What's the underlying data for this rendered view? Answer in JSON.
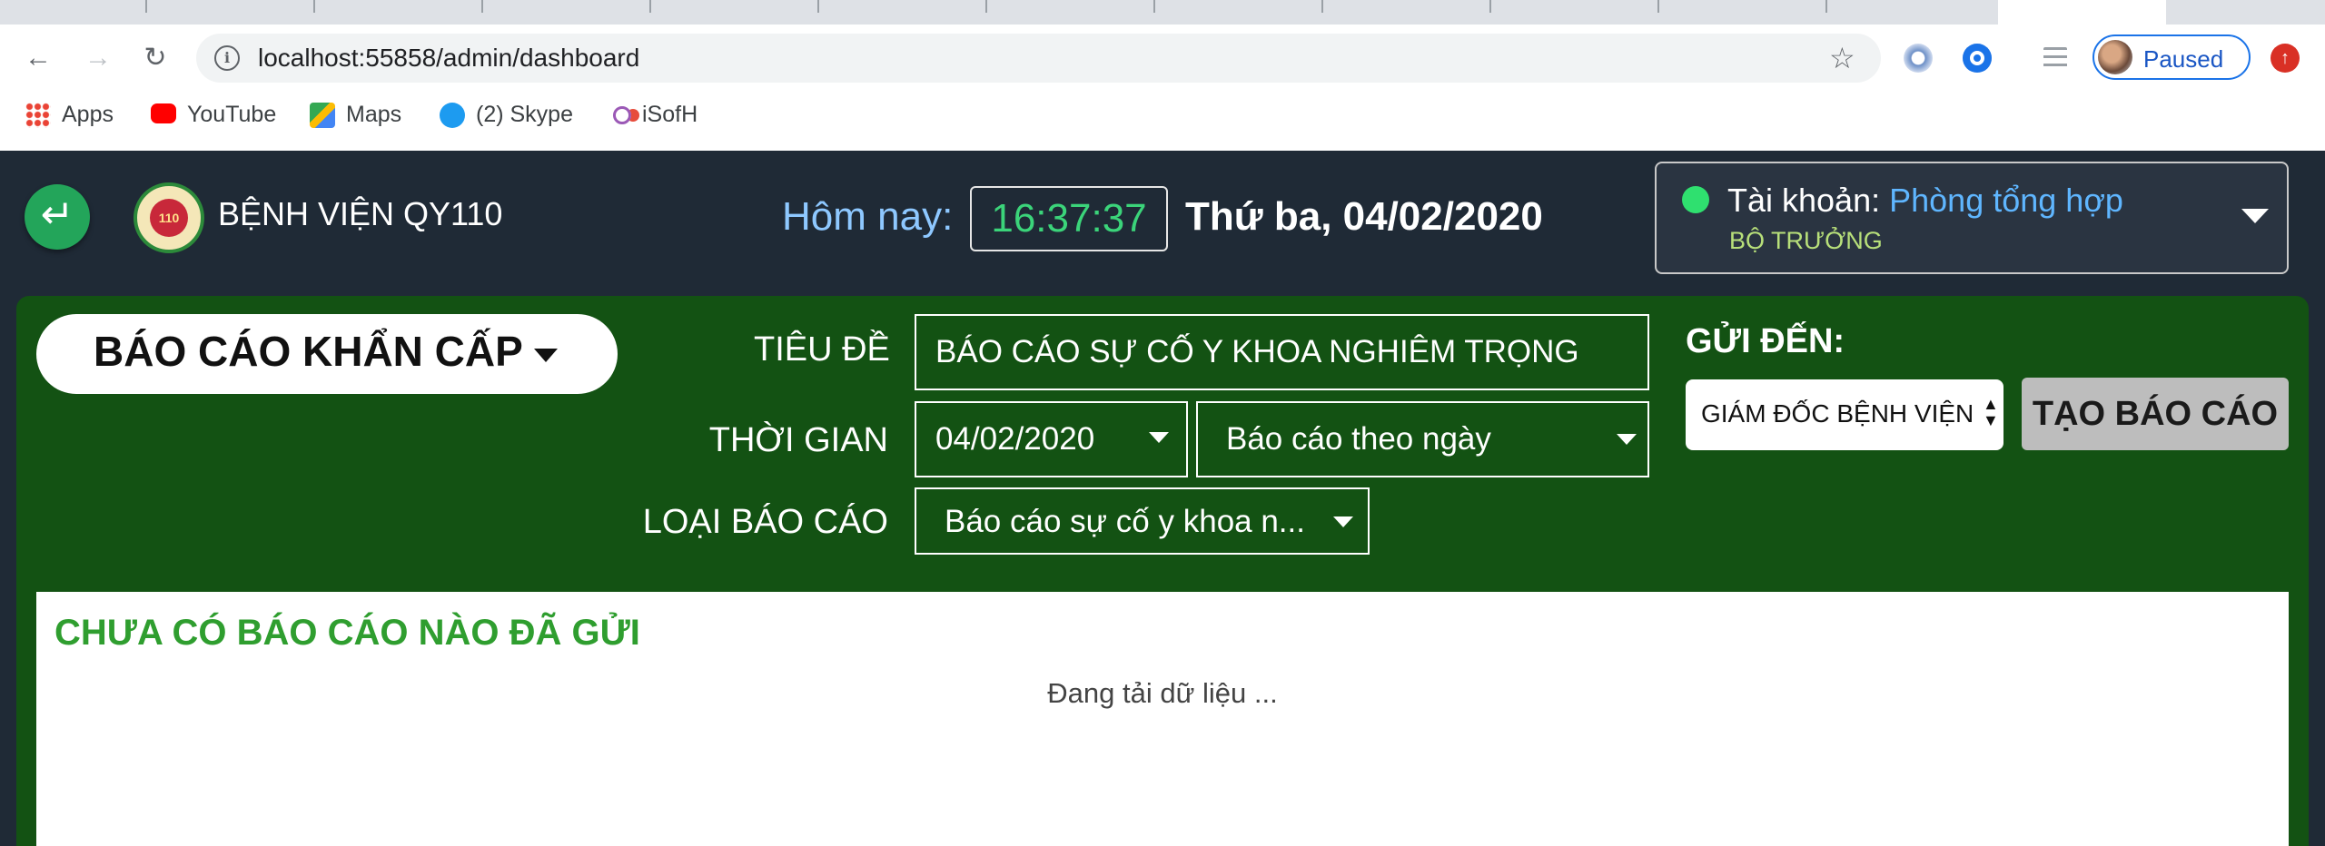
{
  "browser": {
    "url": "localhost:55858/admin/dashboard",
    "profile_label": "Paused",
    "bookmarks": [
      "Apps",
      "YouTube",
      "Maps",
      "(2) Skype",
      "iSofH"
    ]
  },
  "header": {
    "hospital_name": "BỆNH VIỆN QY110",
    "logo_text": "110",
    "today_label": "Hôm nay:",
    "clock": "16:37:37",
    "date": "Thứ ba, 04/02/2020",
    "account_label": "Tài khoản:",
    "account_name": "Phòng tổng hợp",
    "account_role": "BỘ TRƯỞNG"
  },
  "form": {
    "report_type": "BÁO CÁO KHẨN CẤP",
    "title_label": "TIÊU ĐỀ",
    "title_value": "BÁO CÁO SỰ CỐ Y KHOA NGHIÊM TRỌNG",
    "time_label": "THỜI GIAN",
    "date_value": "04/02/2020",
    "period_value": "Báo cáo theo ngày",
    "type_label": "LOẠI BÁO CÁO",
    "type_value": "Báo cáo sự cố y khoa n...",
    "send_to_label": "GỬI ĐẾN:",
    "recipient_value": "GIÁM ĐỐC BỆNH VIỆN",
    "create_button": "TẠO BÁO CÁO"
  },
  "result": {
    "title": "CHƯA CÓ BÁO CÁO NÀO ĐÃ GỬI",
    "loading_text": "Đang tải dữ liệu ..."
  },
  "colors": {
    "panel_green": "#135213",
    "header_dark": "#1f2a36",
    "clock_green": "#3bd47a",
    "account_blue": "#5fb6ff",
    "result_title_green": "#2f9e2f"
  }
}
